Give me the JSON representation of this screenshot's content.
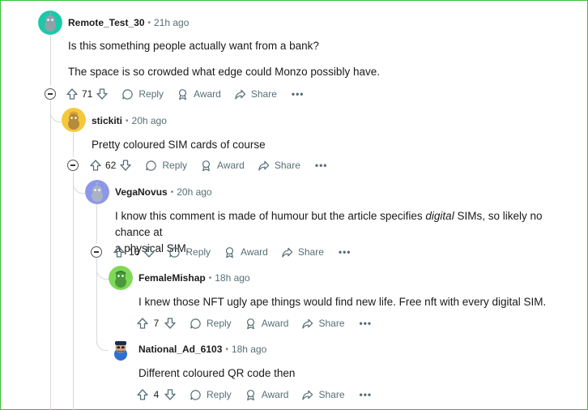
{
  "comments": [
    {
      "username": "Remote_Test_30",
      "time": "21h ago",
      "paragraphs": [
        "Is this something people actually want from a bank?",
        "The space is so crowded what edge could Monzo possibly have."
      ],
      "votes": "71",
      "avatar_color": "#1bc9a8"
    },
    {
      "username": "stickiti",
      "time": "20h ago",
      "paragraphs": [
        "Pretty coloured SIM cards of course"
      ],
      "votes": "62",
      "avatar_color": "#f5c83b"
    },
    {
      "username": "VegaNovus",
      "time": "20h ago",
      "text_before": "I know this comment is made of humour but the article specifies ",
      "text_em": "digital",
      "text_after_line1": " SIMs, so likely no chance at",
      "text_line2": "a physical SIM.",
      "votes": "16",
      "avatar_color": "#8b97e8"
    },
    {
      "username": "FemaleMishap",
      "time": "18h ago",
      "paragraphs": [
        "I knew those NFT ugly ape things would find new life. Free nft with every digital SIM."
      ],
      "votes": "7",
      "avatar_color": "#7ed957"
    },
    {
      "username": "National_Ad_6103",
      "time": "18h ago",
      "paragraphs": [
        "Different coloured QR code then"
      ],
      "votes": "4",
      "avatar_color": "#2f6fd1"
    }
  ],
  "actions": {
    "reply": "Reply",
    "award": "Award",
    "share": "Share",
    "more": "•••"
  },
  "dot": "•"
}
